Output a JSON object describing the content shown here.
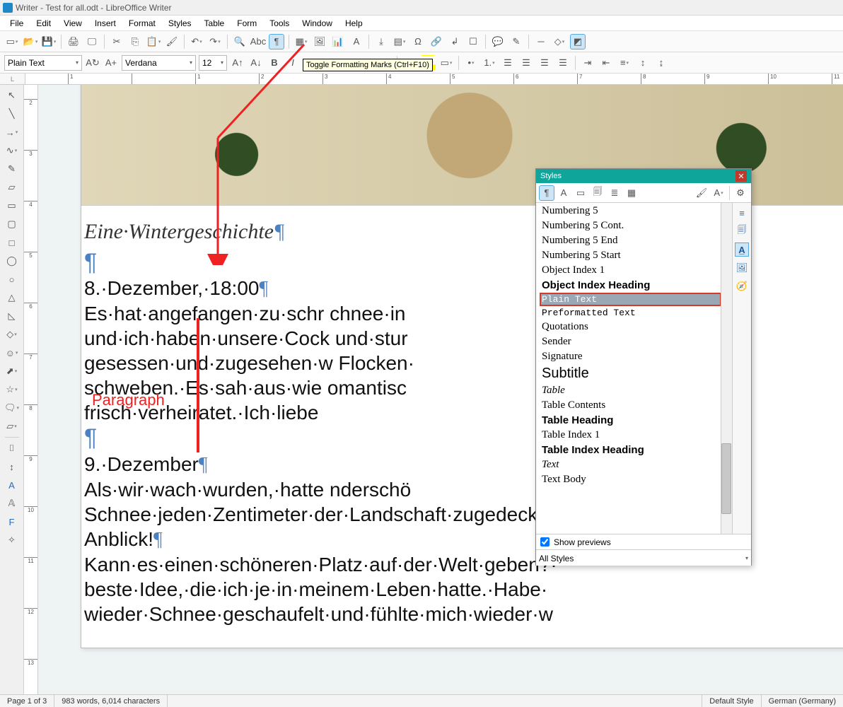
{
  "title": "Writer - Test for all.odt - LibreOffice Writer",
  "menu": [
    "File",
    "Edit",
    "View",
    "Insert",
    "Format",
    "Styles",
    "Table",
    "Form",
    "Tools",
    "Window",
    "Help"
  ],
  "tooltip": "Toggle Formatting Marks (Ctrl+F10)",
  "toolbar2": {
    "style": "Plain Text",
    "font": "Verdana",
    "size": "12"
  },
  "doc": {
    "title_text": "Eine·Wintergeschichte",
    "p1_l1": "8.·Dezember,·18:00",
    "p1_body": [
      "Es·hat·angefangen·zu·schr                                   chnee·in",
      "und·ich·haben·unsere·Cock                                   und·stur",
      "gesessen·und·zugesehen·w                                    Flocken·",
      "schweben.·Es·sah·aus·wie                                    omantisc",
      "frisch·verheiratet.·Ich·liebe"
    ],
    "p2_l1": "9.·Dezember",
    "p2_body": [
      "Als·wir·wach·wurden,·hatte                                  nderschö",
      "Schnee·jeden·Zentimeter·der·Landschaft·zugedeckt.",
      "Anblick!",
      "Kann·es·einen·schöneren·Platz·auf·der·Welt·geben?·",
      "beste·Idee,·die·ich·je·in·meinem·Leben·hatte.·Habe·",
      "wieder·Schnee·geschaufelt·und·fühlte·mich·wieder·w"
    ]
  },
  "annot_label": "Paragraph",
  "styles_panel": {
    "title": "Styles",
    "items": [
      {
        "t": "Numbering 5",
        "cls": ""
      },
      {
        "t": "Numbering 5 Cont.",
        "cls": ""
      },
      {
        "t": "Numbering 5 End",
        "cls": ""
      },
      {
        "t": "Numbering 5 Start",
        "cls": ""
      },
      {
        "t": "Object Index 1",
        "cls": ""
      },
      {
        "t": "Object Index Heading",
        "cls": "bold sans"
      },
      {
        "t": "Plain Text",
        "cls": "mono selected"
      },
      {
        "t": "Preformatted Text",
        "cls": "mono"
      },
      {
        "t": "Quotations",
        "cls": ""
      },
      {
        "t": "Sender",
        "cls": ""
      },
      {
        "t": "Signature",
        "cls": ""
      },
      {
        "t": "Subtitle",
        "cls": "sans",
        "sz": "20"
      },
      {
        "t": "Table",
        "cls": "ital"
      },
      {
        "t": "Table Contents",
        "cls": ""
      },
      {
        "t": "Table Heading",
        "cls": "bold"
      },
      {
        "t": "Table Index 1",
        "cls": ""
      },
      {
        "t": "Table Index Heading",
        "cls": "bold sans"
      },
      {
        "t": "Text",
        "cls": "ital"
      },
      {
        "t": "Text Body",
        "cls": ""
      }
    ],
    "show_previews": "Show previews",
    "filter": "All Styles"
  },
  "status": {
    "page": "Page 1 of 3",
    "words": "983 words, 6,014 characters",
    "style": "Default Style",
    "lang": "German (Germany)"
  },
  "hruler_marks": [
    "1",
    "",
    "1",
    "2",
    "3",
    "4",
    "5",
    "6",
    "7",
    "8",
    "9",
    "10",
    "11"
  ],
  "vruler_marks": [
    "2",
    "3",
    "4",
    "5",
    "6",
    "7",
    "8",
    "9",
    "10",
    "11",
    "12",
    "13"
  ]
}
